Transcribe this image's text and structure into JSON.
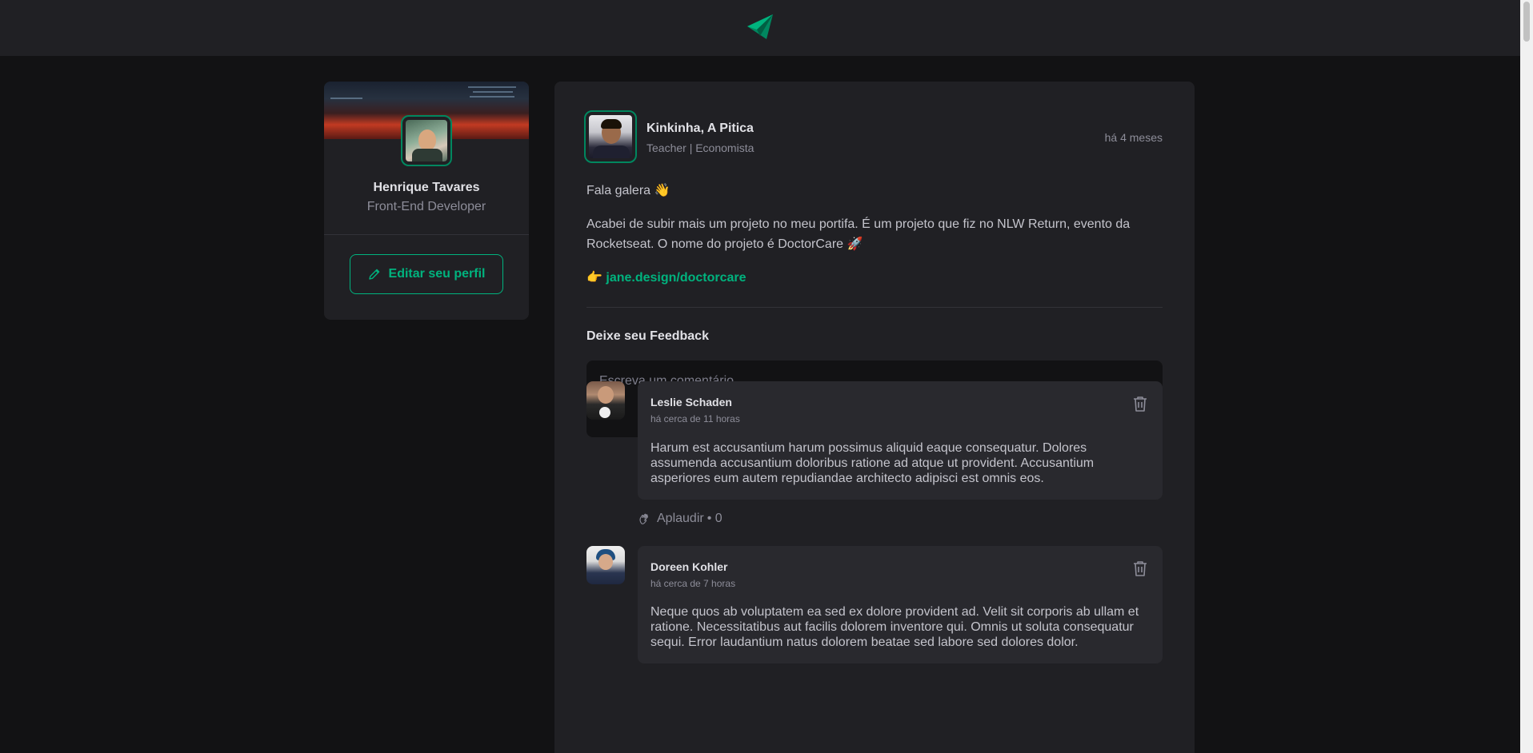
{
  "header": {
    "logo_icon": "paper-plane-logo-icon",
    "accent": "#00b37e"
  },
  "sidebar": {
    "name": "Henrique Tavares",
    "role": "Front-End Developer",
    "edit_button_label": "Editar seu perfil",
    "edit_icon": "pencil-icon"
  },
  "post": {
    "author_name": "Kinkinha, A Pitica",
    "author_role": "Teacher | Economista",
    "published": "há 4 meses",
    "greeting": "Fala galera 👋",
    "body": "Acabei de subir mais um projeto no meu portifa. É um projeto que fiz no NLW Return, evento da Rocketseat. O nome do projeto é DoctorCare 🚀",
    "link_prefix": "👉 ",
    "link_text": "jane.design/doctorcare"
  },
  "feedback": {
    "title": "Deixe seu Feedback",
    "placeholder": "Escreva um comentário...",
    "value": ""
  },
  "comments": [
    {
      "author": "Leslie Schaden",
      "time": "há cerca de 11 horas",
      "text": "Harum est accusantium harum possimus aliquid eaque consequatur. Dolores assumenda accusantium doloribus ratione ad atque ut provident. Accusantium asperiores eum autem repudiandae architecto adipisci est omnis eos.",
      "applaud_label": "Aplaudir",
      "applaud_count": "• 0"
    },
    {
      "author": "Doreen Kohler",
      "time": "há cerca de 7 horas",
      "text": "Neque quos ab voluptatem ea sed ex dolore provident ad. Velit sit corporis ab ullam et ratione. Necessitatibus aut facilis dolorem inventore qui. Omnis ut soluta consequatur sequi. Error laudantium natus dolorem beatae sed labore sed dolores dolor."
    }
  ]
}
